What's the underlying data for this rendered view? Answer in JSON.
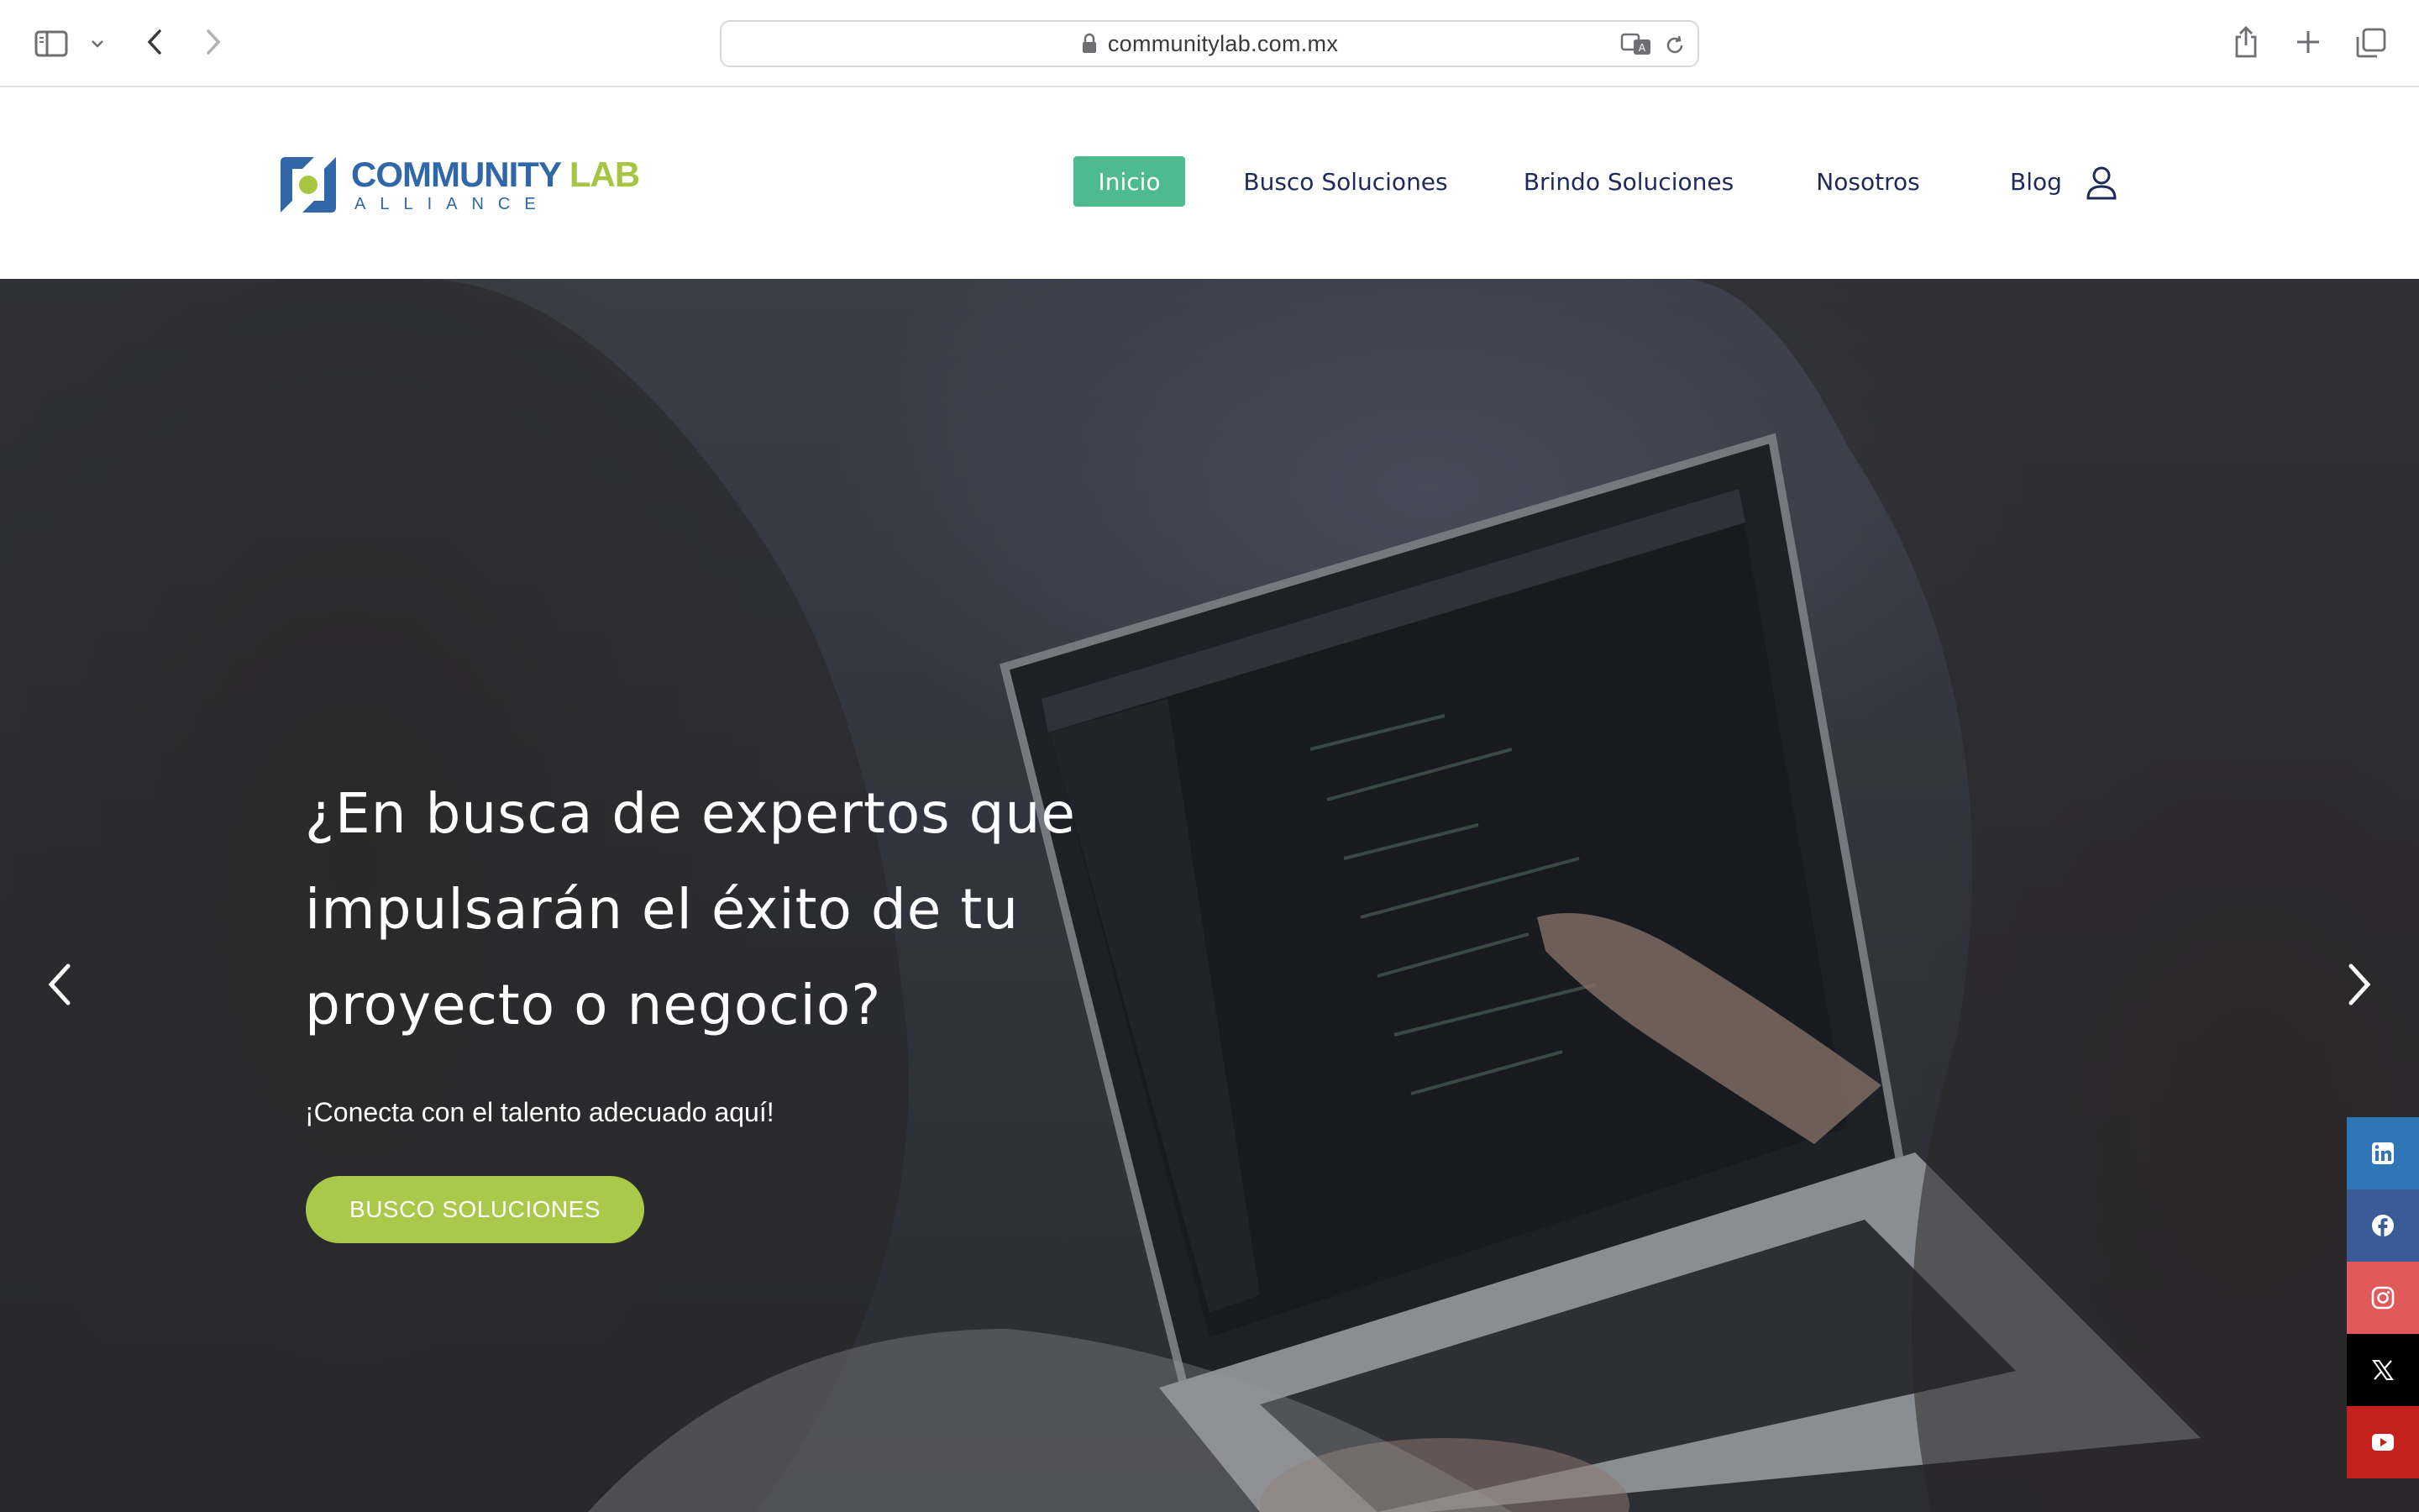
{
  "browser": {
    "url": "communitylab.com.mx"
  },
  "logo": {
    "word1": "COMMUNITY",
    "word2": "LAB",
    "subtitle": "ALLIANCE"
  },
  "nav": {
    "items": [
      {
        "label": "Inicio",
        "active": true
      },
      {
        "label": "Busco Soluciones",
        "active": false
      },
      {
        "label": "Brindo Soluciones",
        "active": false
      },
      {
        "label": "Nosotros",
        "active": false
      },
      {
        "label": "Blog",
        "active": false
      }
    ]
  },
  "hero": {
    "heading_line1": "¿En busca de expertos que",
    "heading_line2": "impulsarán el éxito de tu",
    "heading_line3": "proyecto o negocio?",
    "subtext": "¡Conecta con el talento adecuado aquí!",
    "cta_label": "BUSCO SOLUCIONES"
  },
  "social": {
    "items": [
      {
        "icon": "linkedin-icon",
        "color": "#2e76b6"
      },
      {
        "icon": "facebook-icon",
        "color": "#3b5a98"
      },
      {
        "icon": "instagram-icon",
        "color": "#e05a5a"
      },
      {
        "icon": "x-icon",
        "color": "#000000"
      },
      {
        "icon": "youtube-icon",
        "color": "#c4211c"
      }
    ]
  },
  "colors": {
    "nav_active": "#4dbb8e",
    "nav_text": "#1e2a5a",
    "cta": "#a8c94a",
    "brand_blue": "#2f67a8",
    "brand_green": "#a8c443"
  }
}
